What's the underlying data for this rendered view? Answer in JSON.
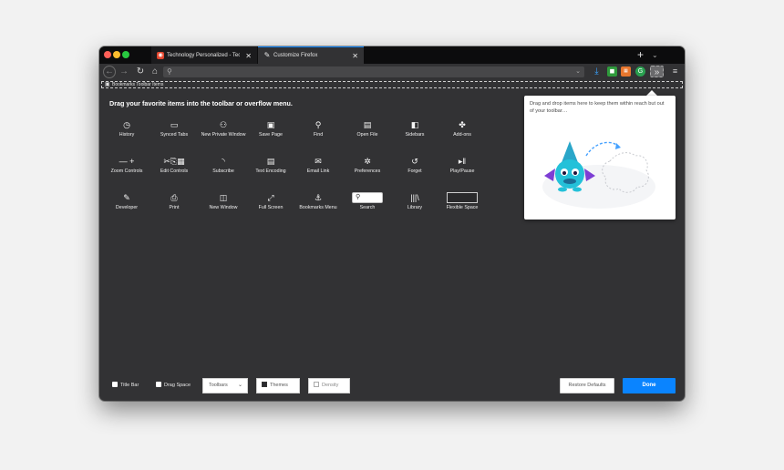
{
  "tabs": [
    {
      "title": "Technology Personalized - Tec",
      "favicon": "firefox-icon"
    },
    {
      "title": "Customize Firefox",
      "favicon": "brush-icon"
    }
  ],
  "toolbar": {
    "bookmarks_toolbar_label": "Bookmarks Toolbar Items"
  },
  "customize": {
    "heading": "Drag your favorite items into the toolbar or overflow menu.",
    "items": [
      {
        "label": "History",
        "icon": "clock-icon",
        "glyph": "◷"
      },
      {
        "label": "Synced Tabs",
        "icon": "laptop-icon",
        "glyph": "▭"
      },
      {
        "label": "New Private Window",
        "icon": "mask-icon",
        "glyph": "⚇"
      },
      {
        "label": "Save Page",
        "icon": "folder-icon",
        "glyph": "▣"
      },
      {
        "label": "Find",
        "icon": "search-icon",
        "glyph": "⚲"
      },
      {
        "label": "Open File",
        "icon": "open-folder-icon",
        "glyph": "▤"
      },
      {
        "label": "Sidebars",
        "icon": "sidebar-icon",
        "glyph": "◧"
      },
      {
        "label": "Add-ons",
        "icon": "puzzle-icon",
        "glyph": "✤"
      },
      {
        "label": "Zoom Controls",
        "icon": "zoom-icon",
        "glyph": "— +"
      },
      {
        "label": "Edit Controls",
        "icon": "scissors-copy-paste-icon",
        "glyph": "✂⎘▦"
      },
      {
        "label": "Subscribe",
        "icon": "rss-icon",
        "glyph": "◝"
      },
      {
        "label": "Text Encoding",
        "icon": "text-encoding-icon",
        "glyph": "▤"
      },
      {
        "label": "Email Link",
        "icon": "envelope-icon",
        "glyph": "✉"
      },
      {
        "label": "Preferences",
        "icon": "gear-icon",
        "glyph": "✲"
      },
      {
        "label": "Forget",
        "icon": "forget-icon",
        "glyph": "↺"
      },
      {
        "label": "Play/Pause",
        "icon": "play-pause-icon",
        "glyph": "▸‖"
      },
      {
        "label": "Developer",
        "icon": "wrench-icon",
        "glyph": "✎"
      },
      {
        "label": "Print",
        "icon": "printer-icon",
        "glyph": "⎙"
      },
      {
        "label": "New Window",
        "icon": "window-icon",
        "glyph": "◫"
      },
      {
        "label": "Full Screen",
        "icon": "fullscreen-icon",
        "glyph": "⤢"
      },
      {
        "label": "Bookmarks Menu",
        "icon": "bookmarks-icon",
        "glyph": "⚓"
      },
      {
        "label": "Search",
        "icon": "search-box-icon",
        "glyph": "⚲"
      },
      {
        "label": "Library",
        "icon": "library-icon",
        "glyph": "|||\\"
      },
      {
        "label": "Flexible Space",
        "icon": "flexible-space-icon",
        "glyph": ""
      }
    ]
  },
  "overflow_panel": {
    "text": "Drag and drop items here to keep them within reach but out of your toolbar…"
  },
  "footer": {
    "title_bar": "Title Bar",
    "drag_space": "Drag Space",
    "toolbars": "Toolbars",
    "themes": "Themes",
    "density": "Density",
    "restore_defaults": "Restore Defaults",
    "done": "Done"
  },
  "colors": {
    "accent": "#0a84ff",
    "background": "#323234",
    "tabbar": "#0c0c0d"
  }
}
